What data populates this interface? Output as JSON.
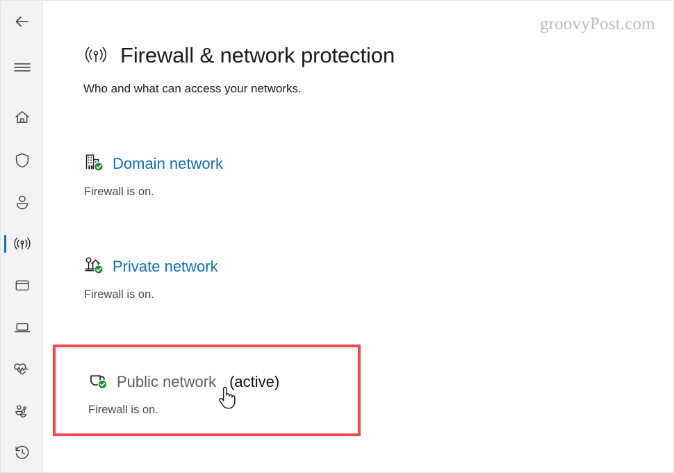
{
  "watermark": "groovyPost.com",
  "sidebar": {
    "items": [
      {
        "name": "back-button",
        "icon": "back-arrow-icon",
        "label": "Back",
        "selected": false
      },
      {
        "name": "menu-button",
        "icon": "hamburger-menu-icon",
        "label": "Menu",
        "selected": false
      },
      {
        "name": "nav-home",
        "icon": "home-icon",
        "label": "Home",
        "selected": false
      },
      {
        "name": "nav-virus",
        "icon": "shield-icon",
        "label": "Virus & threat protection",
        "selected": false
      },
      {
        "name": "nav-account",
        "icon": "person-icon",
        "label": "Account protection",
        "selected": false
      },
      {
        "name": "nav-firewall",
        "icon": "wifi-signal-icon",
        "label": "Firewall & network protection",
        "selected": true
      },
      {
        "name": "nav-app-browser",
        "icon": "app-window-icon",
        "label": "App & browser control",
        "selected": false
      },
      {
        "name": "nav-device-security",
        "icon": "laptop-icon",
        "label": "Device security",
        "selected": false
      },
      {
        "name": "nav-device-health",
        "icon": "heart-pulse-icon",
        "label": "Device performance & health",
        "selected": false
      },
      {
        "name": "nav-family",
        "icon": "family-people-icon",
        "label": "Family options",
        "selected": false
      },
      {
        "name": "nav-history",
        "icon": "history-clock-icon",
        "label": "Protection history",
        "selected": false
      }
    ]
  },
  "page": {
    "icon": "wifi-signal-icon",
    "title": "Firewall & network protection",
    "subtitle": "Who and what can access your networks."
  },
  "profiles": [
    {
      "key": "domain",
      "icon": "office-building-icon",
      "badge": "green-check-badge",
      "link": "Domain network",
      "active_suffix": "",
      "status": "Firewall is on.",
      "highlighted": false
    },
    {
      "key": "private",
      "icon": "house-tree-icon",
      "badge": "green-check-badge",
      "link": "Private network",
      "active_suffix": "",
      "status": "Firewall is on.",
      "highlighted": false
    },
    {
      "key": "public",
      "icon": "coffee-cup-icon",
      "badge": "green-check-badge",
      "link": "Public network",
      "active_suffix": "(active)",
      "status": "Firewall is on.",
      "highlighted": true
    }
  ],
  "colors": {
    "link_blue": "#0f6cbd",
    "selected_indicator": "#0a72cd",
    "highlight_red": "#f4494b",
    "badge_green": "#18922b",
    "sidebar_bg": "#f3f3f3",
    "text_primary": "#1b1b1b",
    "text_muted": "#5d5d5d",
    "watermark_gray": "#bcbcbc"
  },
  "cursor": {
    "type": "pointing-hand-cursor"
  }
}
